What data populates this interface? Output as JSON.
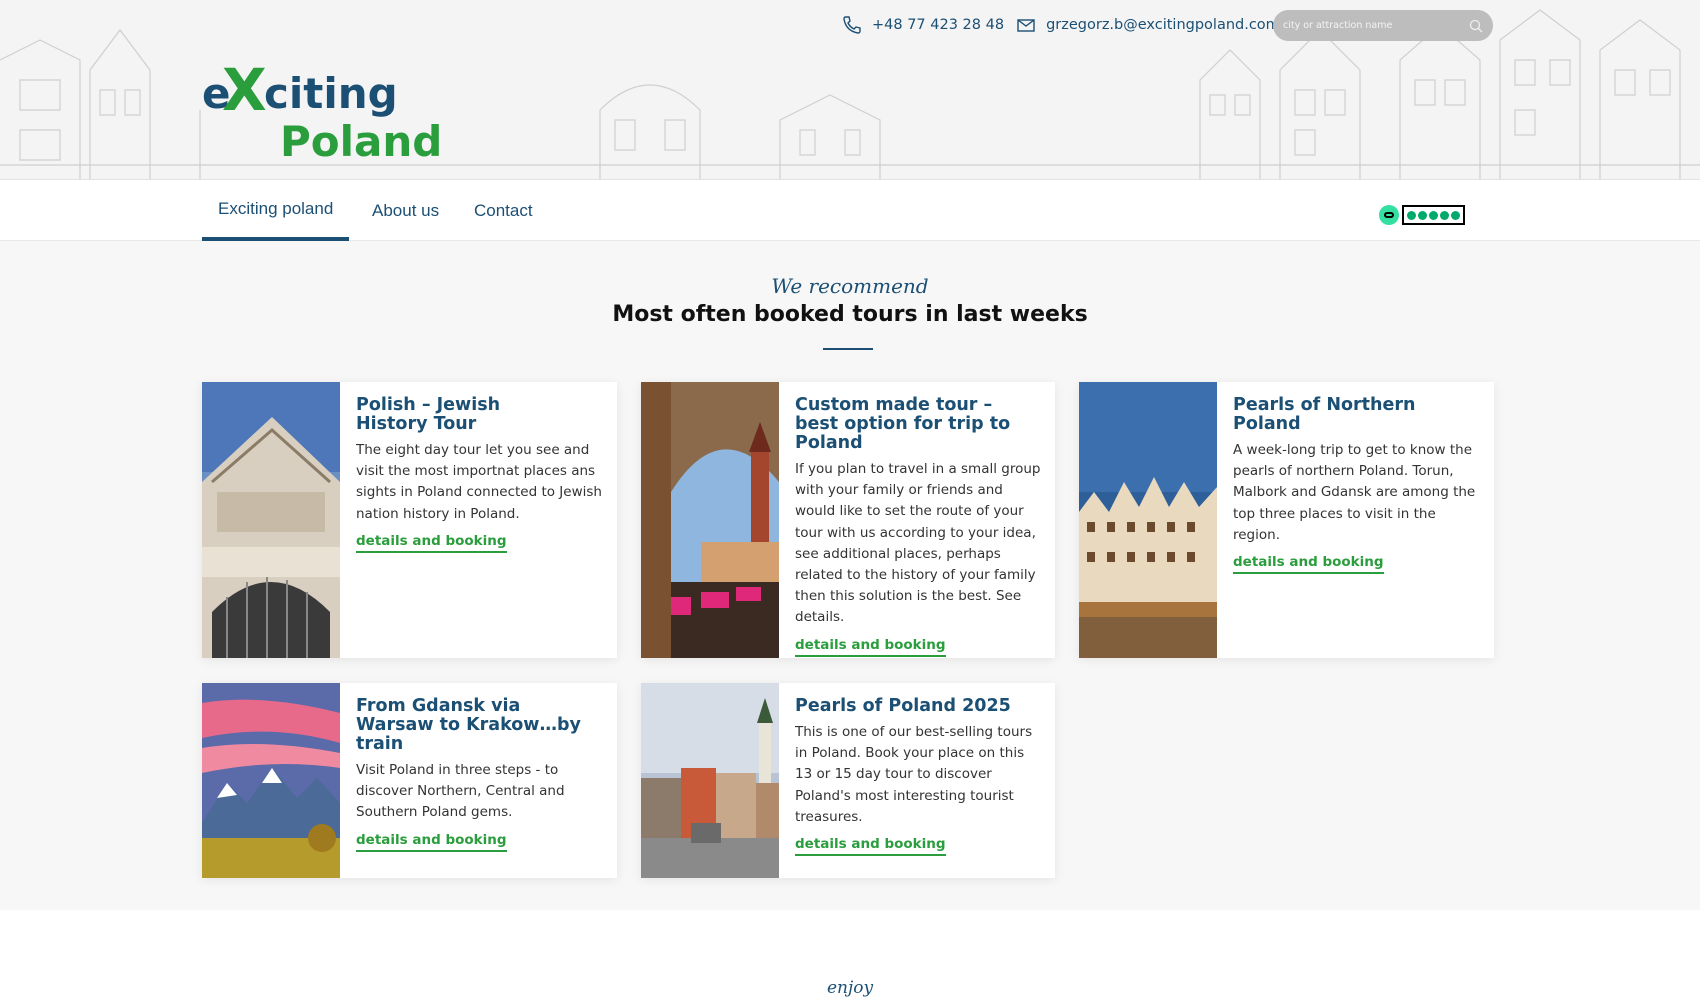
{
  "header": {
    "phone": "+48 77 423 28 48",
    "email": "grzegorz.b@excitingpoland.com",
    "search_placeholder": "city or attraction name",
    "logo": {
      "line1": "eXciting",
      "line2": "Poland"
    }
  },
  "nav": {
    "items": [
      {
        "label": "Exciting poland"
      },
      {
        "label": "About us"
      },
      {
        "label": "Contact"
      }
    ]
  },
  "recommend": {
    "script": "We recommend",
    "title": "Most often booked tours in last weeks"
  },
  "tours": [
    {
      "title": "Polish – Jewish History Tour",
      "description": "The eight day tour let you see and visit the most importnat places ans sights in Poland connected to Jewish nation history in Poland.",
      "link": "details and booking"
    },
    {
      "title": "Custom made tour – best option for trip to Poland",
      "description": "If you plan to travel in a small group with your family or friends and would like to set the route of your tour with us according to your idea, see additional places, perhaps related to the history of your family then this solution is the best. See details.",
      "link": "details and booking"
    },
    {
      "title": "Pearls of Northern Poland",
      "description": "A week-long trip to get to know the pearls of northern Poland. Torun, Malbork and Gdansk are among the top three places to visit in the region.",
      "link": "details and booking"
    },
    {
      "title": "From Gdansk via Warsaw to Krakow…by train",
      "description": "Visit Poland in three steps - to discover Northern, Central and Southern Poland gems.",
      "link": "details and booking"
    },
    {
      "title": "Pearls of Poland 2025",
      "description": "This is one of our best-selling tours in Poland. Book your place on this 13 or 15 day tour to discover Poland's most interesting tourist treasures.",
      "link": "details and booking"
    }
  ],
  "enjoy": {
    "script": "enjoy"
  },
  "colors": {
    "navy": "#1b4f74",
    "green": "#2a9d3c",
    "tripadvisor": "#34e0a1"
  }
}
